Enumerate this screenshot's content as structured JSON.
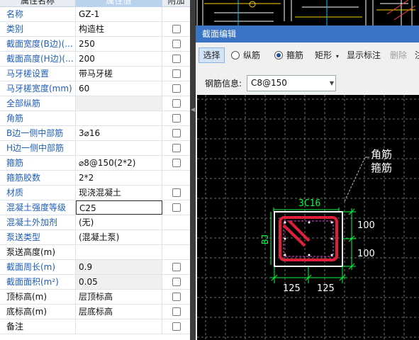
{
  "props": {
    "header": {
      "name": "属性名称",
      "value": "属性值",
      "add": "附加"
    },
    "rows": [
      {
        "name": "名称",
        "value": "GZ-1",
        "blue": true,
        "checkbox": false
      },
      {
        "name": "类别",
        "value": "构造柱",
        "blue": true,
        "checkbox": true
      },
      {
        "name": "截面宽度(B边)(...",
        "value": "250",
        "blue": true,
        "checkbox": true
      },
      {
        "name": "截面高度(H边)(...",
        "value": "200",
        "blue": true,
        "checkbox": true
      },
      {
        "name": "马牙槎设置",
        "value": "带马牙槎",
        "blue": true,
        "checkbox": true
      },
      {
        "name": "马牙槎宽度(mm)",
        "value": "60",
        "blue": true,
        "checkbox": true
      },
      {
        "name": "全部纵筋",
        "value": "",
        "blue": true,
        "checkbox": true,
        "grayval": true
      },
      {
        "name": "角筋",
        "value": "",
        "blue": true,
        "checkbox": true
      },
      {
        "name": "B边一侧中部筋",
        "value": "3⌀16",
        "blue": true,
        "checkbox": true
      },
      {
        "name": "H边一侧中部筋",
        "value": "",
        "blue": true,
        "checkbox": true
      },
      {
        "name": "箍筋",
        "value": "⌀8@150(2*2)",
        "blue": true,
        "checkbox": true
      },
      {
        "name": "箍筋胶数",
        "value": "2*2",
        "blue": true,
        "checkbox": false
      },
      {
        "name": "材质",
        "value": "现浇混凝土",
        "blue": true,
        "checkbox": true
      },
      {
        "name": "混凝土强度等级",
        "value": "C25",
        "blue": true,
        "checkbox": true,
        "selected": true
      },
      {
        "name": "混凝土外加剂",
        "value": "(无)",
        "blue": true,
        "checkbox": false
      },
      {
        "name": "泵送类型",
        "value": "(混凝土泵)",
        "blue": true,
        "checkbox": false
      },
      {
        "name": "泵送高度(m)",
        "value": "",
        "blue": false,
        "checkbox": false
      },
      {
        "name": "截面周长(m)",
        "value": "0.9",
        "blue": true,
        "checkbox": true,
        "grayval": true,
        "graytext": true
      },
      {
        "name": "截面面积(m²)",
        "value": "0.05",
        "blue": true,
        "checkbox": true,
        "grayval": true,
        "graytext": true
      },
      {
        "name": "顶标高(m)",
        "value": "层顶标高",
        "blue": false,
        "checkbox": true
      },
      {
        "name": "底标高(m)",
        "value": "层底标高",
        "blue": false,
        "checkbox": true
      },
      {
        "name": "备注",
        "value": "",
        "blue": false,
        "checkbox": true
      }
    ]
  },
  "dialog": {
    "title": "截面编辑",
    "toolbar": {
      "select": "选择",
      "longitudinal": "纵筋",
      "stirrup": "箍筋",
      "shape": "矩形",
      "show_dims": "显示标注",
      "delete": "删除",
      "overflow": "注"
    },
    "rebar_label": "钢筋信息:",
    "rebar_value": "C8@150"
  },
  "drawing": {
    "corner_label": "角筋",
    "stirrup_label": "箍筋",
    "top_bar": "3C16",
    "side_label": "BJ",
    "dim_right_top": "100",
    "dim_right_bottom": "100",
    "dim_bottom_left": "125",
    "dim_bottom_right": "125"
  },
  "colors": {
    "dialog_title_bg": "#3a74c4",
    "rebar_green": "#00ff40",
    "stirrup_red": "#e0203a",
    "canvas_bg": "#000000"
  }
}
